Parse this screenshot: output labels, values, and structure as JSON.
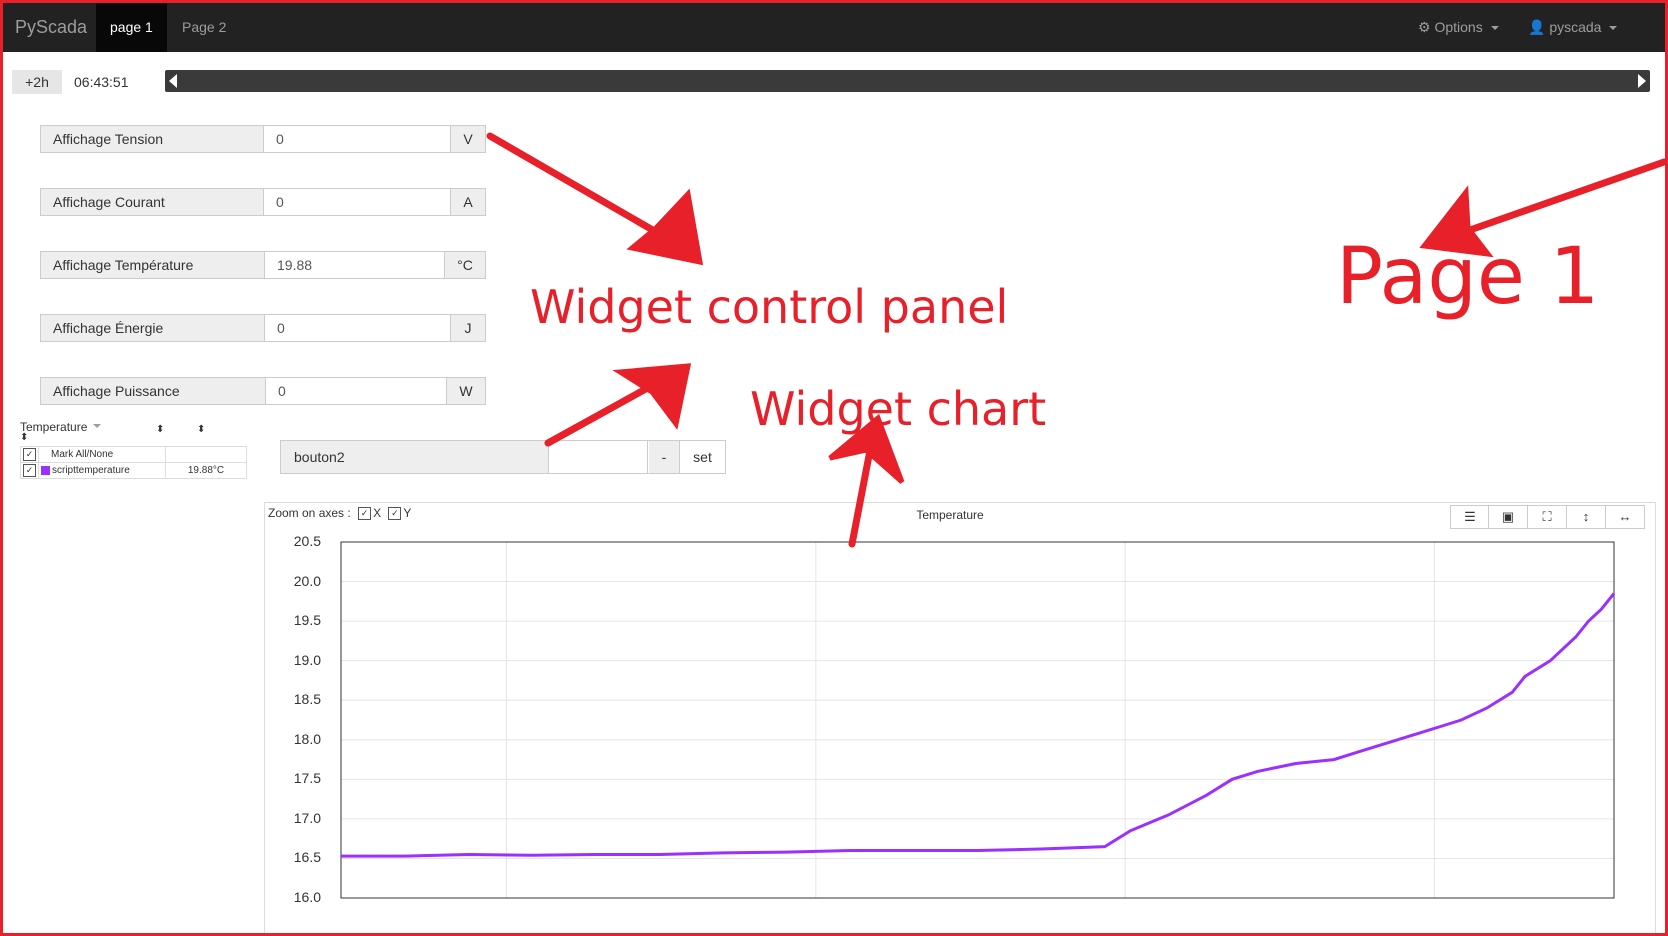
{
  "navbar": {
    "brand": "PyScada",
    "tabs": [
      {
        "label": "page 1",
        "active": true
      },
      {
        "label": "Page 2",
        "active": false
      }
    ],
    "options_label": "Options",
    "user_label": "pyscada"
  },
  "timebar": {
    "range_button": "+2h",
    "time": "06:43:51"
  },
  "controls": [
    {
      "label": "Affichage Tension",
      "value": "0",
      "unit": "V"
    },
    {
      "label": "Affichage Courant",
      "value": "0",
      "unit": "A"
    },
    {
      "label": "Affichage Température",
      "value": "19.88",
      "unit": "°C"
    },
    {
      "label": "Affichage Énergie",
      "value": "0",
      "unit": "J"
    },
    {
      "label": "Affichage Puissance",
      "value": "0",
      "unit": "W"
    }
  ],
  "legend": {
    "title": "Temperature",
    "mark_all": "Mark All/None",
    "series_name": "scripttemperature",
    "series_value": "19.88°C",
    "series_color": "#9b30ff"
  },
  "command": {
    "label": "bouton2",
    "value": "",
    "minus_label": "-",
    "set_label": "set"
  },
  "chart_toolbar": {
    "zoom_label": "Zoom on axes :",
    "x_label": "X",
    "y_label": "Y",
    "check_mark": "✓",
    "icons": [
      "list-icon",
      "image-icon",
      "expand-icon",
      "vertical-resize-icon",
      "horizontal-resize-icon"
    ],
    "icon_glyphs": [
      "☰",
      "▣",
      "⛶",
      "↕",
      "↔"
    ]
  },
  "chart_data": {
    "type": "line",
    "title": "Temperature",
    "xlabel": "",
    "ylabel": "",
    "ylim": [
      16.0,
      20.5
    ],
    "yticks": [
      "20.5",
      "20.0",
      "19.5",
      "19.0",
      "18.5",
      "18.0",
      "17.5",
      "17.0",
      "16.5",
      "16.0"
    ],
    "grid": true,
    "series": [
      {
        "name": "scripttemperature",
        "color": "#9b30ff",
        "x": [
          0,
          5,
          10,
          15,
          20,
          25,
          30,
          35,
          40,
          45,
          50,
          55,
          60,
          62,
          65,
          68,
          70,
          72,
          75,
          78,
          80,
          82,
          85,
          87,
          88,
          90,
          92,
          93,
          95,
          97,
          98,
          99,
          100
        ],
        "values": [
          16.53,
          16.53,
          16.55,
          16.54,
          16.55,
          16.55,
          16.57,
          16.58,
          16.6,
          16.6,
          16.6,
          16.62,
          16.65,
          16.85,
          17.05,
          17.3,
          17.5,
          17.6,
          17.7,
          17.75,
          17.85,
          17.95,
          18.1,
          18.2,
          18.25,
          18.4,
          18.6,
          18.8,
          19.0,
          19.3,
          19.5,
          19.65,
          19.85
        ]
      }
    ]
  },
  "annotations": {
    "control_panel": "Widget control panel",
    "chart": "Widget chart",
    "page": "Page 1"
  }
}
